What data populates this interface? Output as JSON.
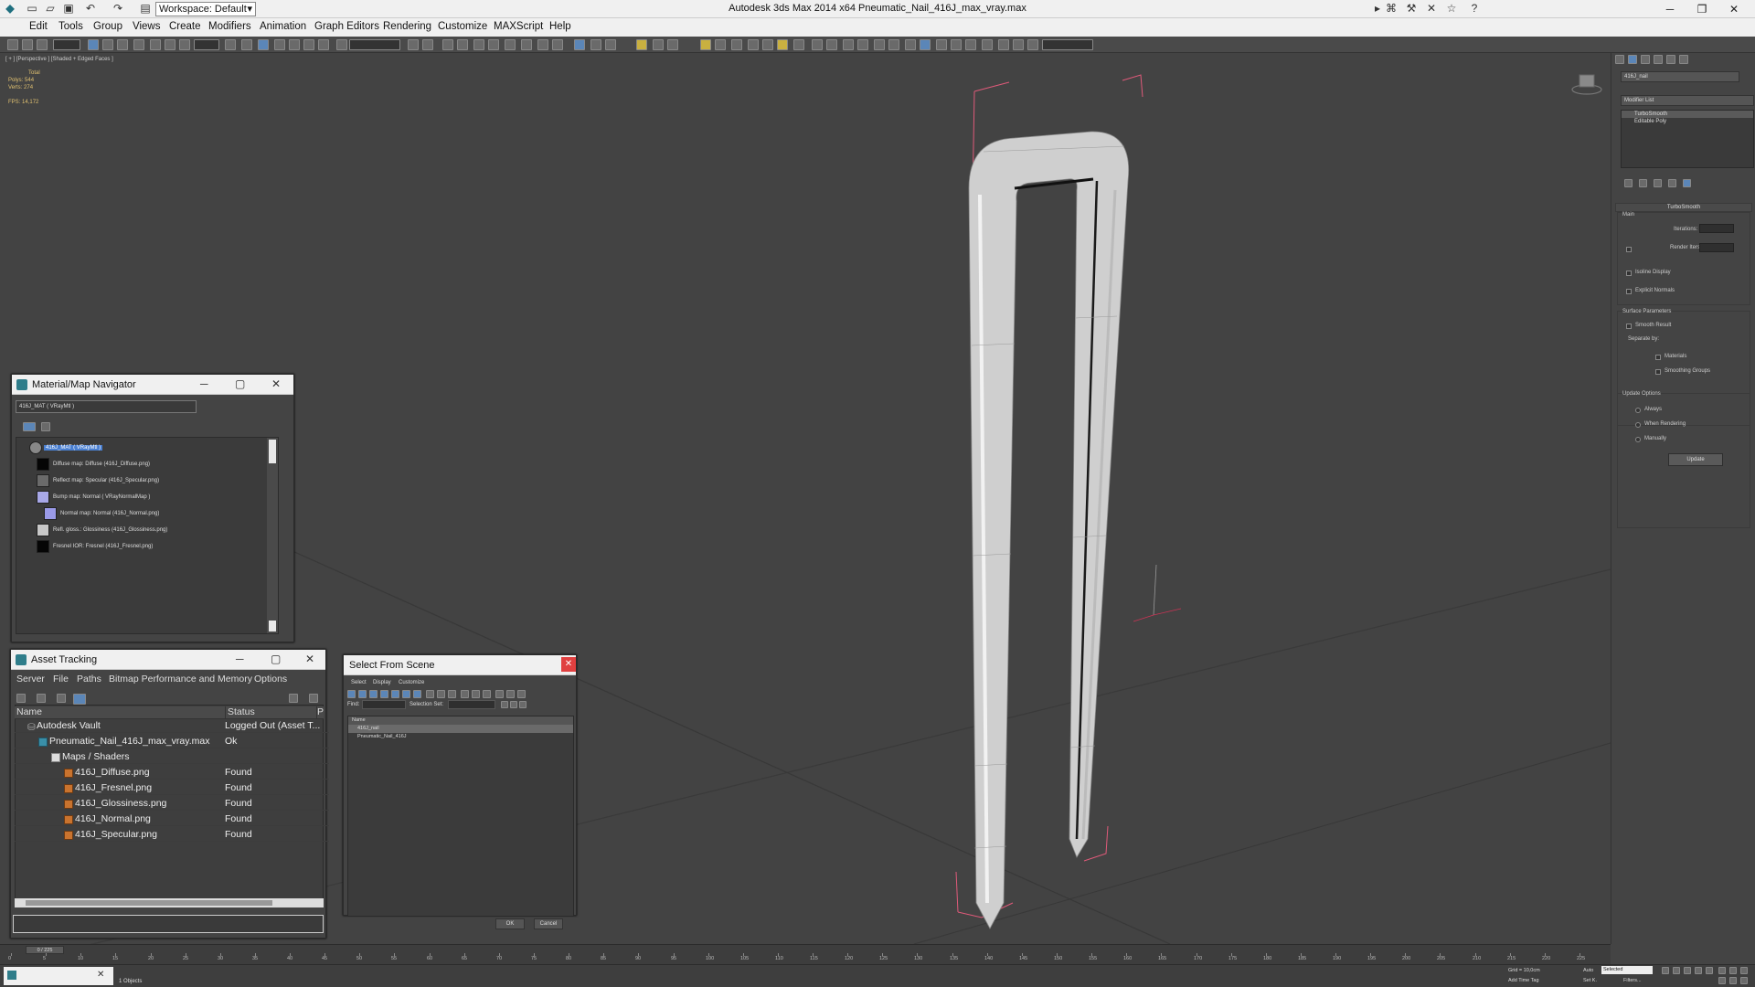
{
  "window": {
    "title": "Autodesk 3ds Max  2014 x64      Pneumatic_Nail_416J_max_vray.max",
    "workspace": "Workspace: Default"
  },
  "menu": [
    "Edit",
    "Tools",
    "Group",
    "Views",
    "Create",
    "Modifiers",
    "Animation",
    "Graph Editors",
    "Rendering",
    "Customize",
    "MAXScript",
    "Help"
  ],
  "viewport": {
    "label": "[ + ] [Perspective ] [Shaded + Edged Faces ]",
    "stats": {
      "total_label": "Total",
      "polys_label": "Polys:",
      "polys": "544",
      "verts_label": "Verts:",
      "verts": "274",
      "fps_label": "FPS:",
      "fps": "14,172"
    }
  },
  "command_panel": {
    "object_name": "416J_nail",
    "modifier_list": "Modifier List",
    "stack": [
      "TurboSmooth",
      "Editable Poly"
    ],
    "turbosmooth": {
      "title": "TurboSmooth",
      "main_label": "Main",
      "iterations_label": "Iterations:",
      "render_iters_label": "Render Iters:",
      "isoline_label": "Isoline Display",
      "explicit_normals_label": "Explicit Normals",
      "surface_params_label": "Surface Parameters",
      "smooth_result_label": "Smooth Result",
      "separate_by_label": "Separate by:",
      "materials_label": "Materials",
      "smoothing_groups_label": "Smoothing Groups",
      "update_options_label": "Update Options",
      "always_label": "Always",
      "when_rendering_label": "When Rendering",
      "manually_label": "Manually",
      "update_button": "Update"
    }
  },
  "material_navigator": {
    "title": "Material/Map Navigator",
    "field": "416J_MAT  ( VRayMtl )",
    "rows": [
      {
        "label": "416J_MAT  ( VRayMtl )",
        "swatch": "#888888",
        "selected": true
      },
      {
        "label": "Diffuse map: Diffuse (416J_Diffuse.png)",
        "swatch": "#050505"
      },
      {
        "label": "Reflect map: Specular (416J_Specular.png)",
        "swatch": "#6a6a6a"
      },
      {
        "label": "Bump map: Normal  ( VRayNormalMap )",
        "swatch": "#a8a8e8"
      },
      {
        "label": "Normal map: Normal (416J_Normal.png)",
        "swatch": "#9a9ae8"
      },
      {
        "label": "Refl. gloss.: Glossiness (416J_Glossiness.png)",
        "swatch": "#c8c8c8"
      },
      {
        "label": "Fresnel IOR: Fresnel (416J_Fresnel.png)",
        "swatch": "#050505"
      }
    ]
  },
  "asset_tracking": {
    "title": "Asset Tracking",
    "menu": [
      "Server",
      "File",
      "Paths",
      "Bitmap Performance and Memory",
      "Options"
    ],
    "columns": [
      "Name",
      "Status",
      "Pro"
    ],
    "rows": [
      {
        "name": "Autodesk Vault",
        "status": "Logged Out (Asset T...",
        "indent": 0
      },
      {
        "name": "Pneumatic_Nail_416J_max_vray.max",
        "status": "Ok",
        "indent": 1
      },
      {
        "name": "Maps / Shaders",
        "status": "",
        "indent": 2
      },
      {
        "name": "416J_Diffuse.png",
        "status": "Found",
        "indent": 3
      },
      {
        "name": "416J_Fresnel.png",
        "status": "Found",
        "indent": 3
      },
      {
        "name": "416J_Glossiness.png",
        "status": "Found",
        "indent": 3
      },
      {
        "name": "416J_Normal.png",
        "status": "Found",
        "indent": 3
      },
      {
        "name": "416J_Specular.png",
        "status": "Found",
        "indent": 3
      }
    ]
  },
  "select_from_scene": {
    "title": "Select From Scene",
    "menu": [
      "Select",
      "Display",
      "Customize"
    ],
    "find_label": "Find:",
    "selection_set_label": "Selection Set:",
    "column": "Name",
    "items": [
      "416J_nail",
      "Pneumatic_Nail_416J"
    ],
    "ok": "OK",
    "cancel": "Cancel"
  },
  "timeline": {
    "frame": "0 / 225",
    "ticks": [
      "0",
      "5",
      "10",
      "15",
      "20",
      "25",
      "30",
      "35",
      "40",
      "45",
      "50",
      "55",
      "60",
      "65",
      "70",
      "75",
      "80",
      "85",
      "90",
      "95",
      "100",
      "105",
      "110",
      "115",
      "120",
      "125",
      "130",
      "135",
      "140",
      "145",
      "150",
      "155",
      "160",
      "165",
      "170",
      "175",
      "180",
      "185",
      "190",
      "195",
      "200",
      "205",
      "210",
      "215",
      "220",
      "225"
    ]
  },
  "status": {
    "selected": "1 Objects",
    "grid": "Grid = 10,0cm",
    "auto_label": "Auto",
    "selected_label": "Selected",
    "set_key": "Set K.",
    "filters": "Filters...",
    "add_time_tag": "Add Time Tag"
  }
}
